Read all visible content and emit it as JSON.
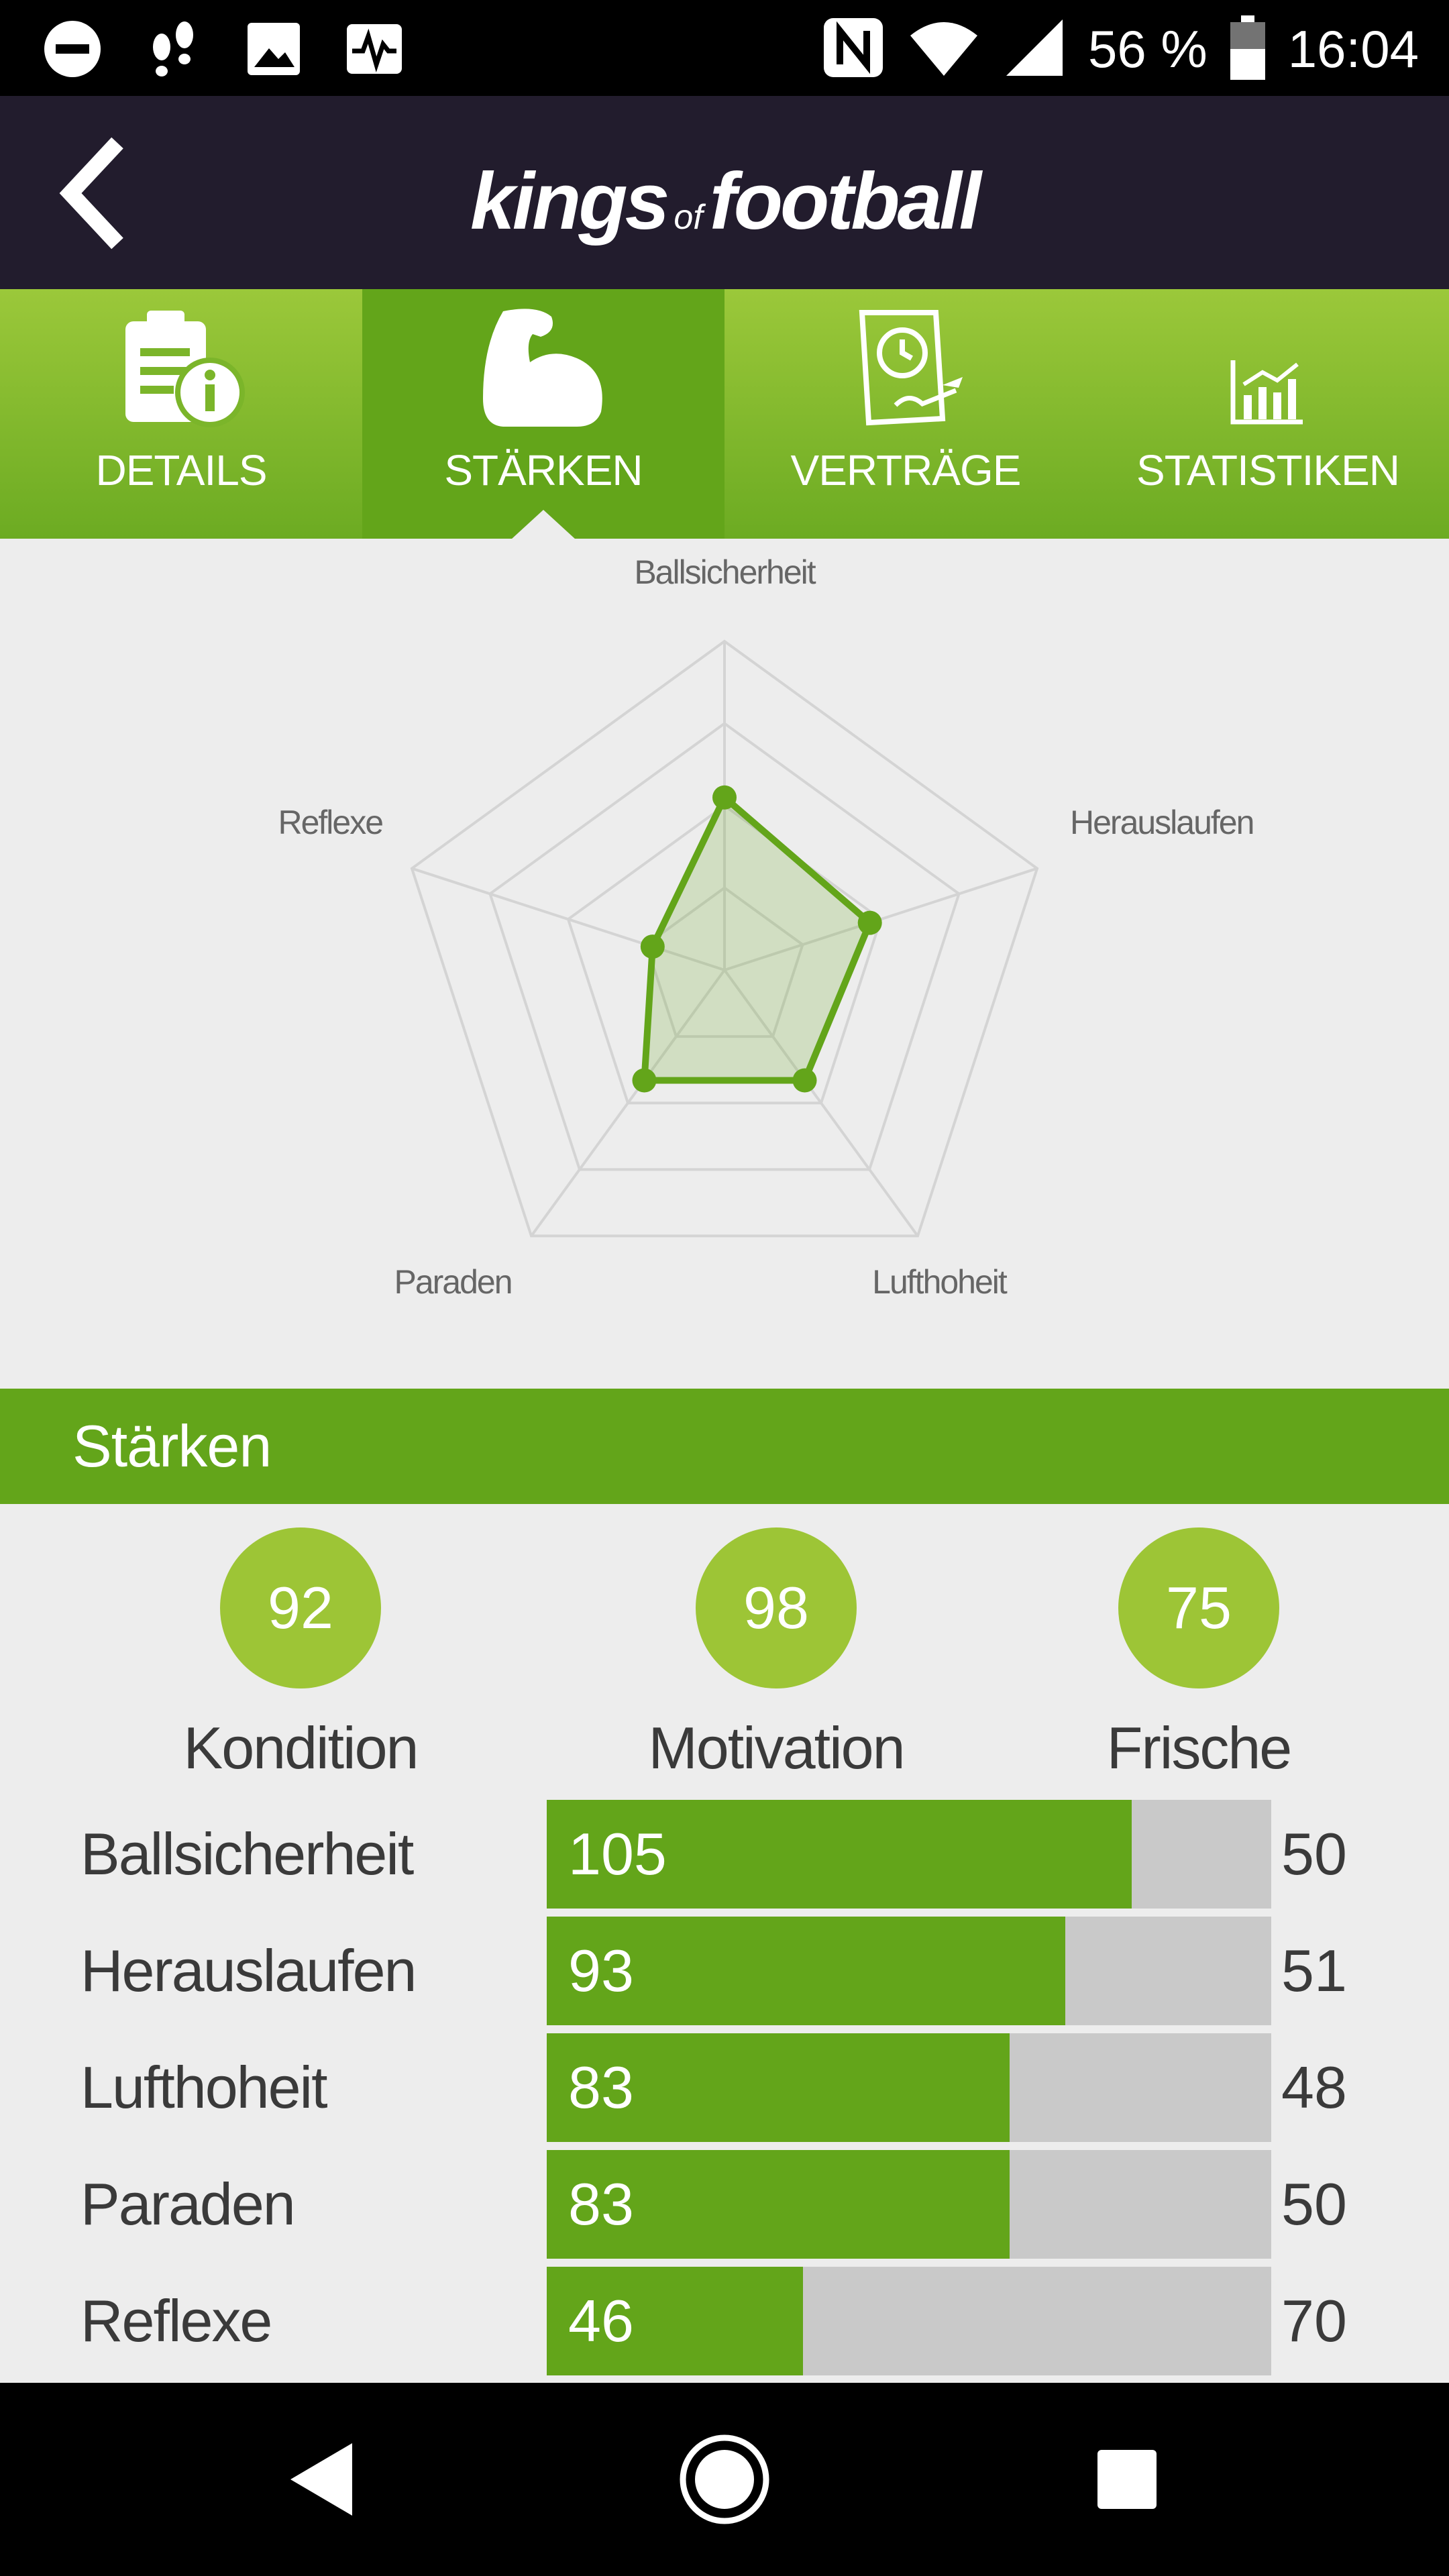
{
  "status_bar": {
    "battery_percent": "56 %",
    "time": "16:04",
    "left_icons": [
      "do-not-disturb-icon",
      "footsteps-icon",
      "image-icon",
      "activity-icon"
    ],
    "right_icons": [
      "nfc-icon",
      "wifi-icon",
      "signal-icon",
      "battery-icon"
    ]
  },
  "header": {
    "logo_part1": "kings",
    "logo_of": "of",
    "logo_part2": "football",
    "back_icon": "chevron-left-icon"
  },
  "tabs": [
    {
      "label": "DETAILS",
      "icon": "document-info-icon",
      "active": false
    },
    {
      "label": "STÄRKEN",
      "icon": "bicep-icon",
      "active": true
    },
    {
      "label": "VERTRÄGE",
      "icon": "contract-icon",
      "active": false
    },
    {
      "label": "STATISTIKEN",
      "icon": "chart-icon",
      "active": false
    }
  ],
  "chart_data": {
    "type": "radar",
    "axes": [
      "Ballsicherheit",
      "Herauslaufen",
      "Lufthoheit",
      "Paraden",
      "Reflexe"
    ],
    "values": [
      105,
      93,
      83,
      83,
      46
    ],
    "range": [
      0,
      200
    ],
    "grid_levels": 4,
    "colors": {
      "line": "#63a51a",
      "fill": "#63a51a",
      "grid": "#d4d4d4"
    }
  },
  "section": {
    "title": "Stärken"
  },
  "circles": [
    {
      "value": "92",
      "label": "Kondition"
    },
    {
      "value": "98",
      "label": "Motivation"
    },
    {
      "value": "75",
      "label": "Frische"
    }
  ],
  "bars": {
    "max": 130,
    "items": [
      {
        "label": "Ballsicherheit",
        "value": 105,
        "right": "50"
      },
      {
        "label": "Herauslaufen",
        "value": 93,
        "right": "51"
      },
      {
        "label": "Lufthoheit",
        "value": 83,
        "right": "48"
      },
      {
        "label": "Paraden",
        "value": 83,
        "right": "50"
      },
      {
        "label": "Reflexe",
        "value": 46,
        "right": "70"
      }
    ]
  },
  "nav_bar": {
    "icons": [
      "back-triangle-icon",
      "home-circle-icon",
      "recents-square-icon"
    ]
  },
  "colors": {
    "accent_green": "#63a51a",
    "light_green": "#9dc536",
    "header_dark": "#221c2d"
  }
}
